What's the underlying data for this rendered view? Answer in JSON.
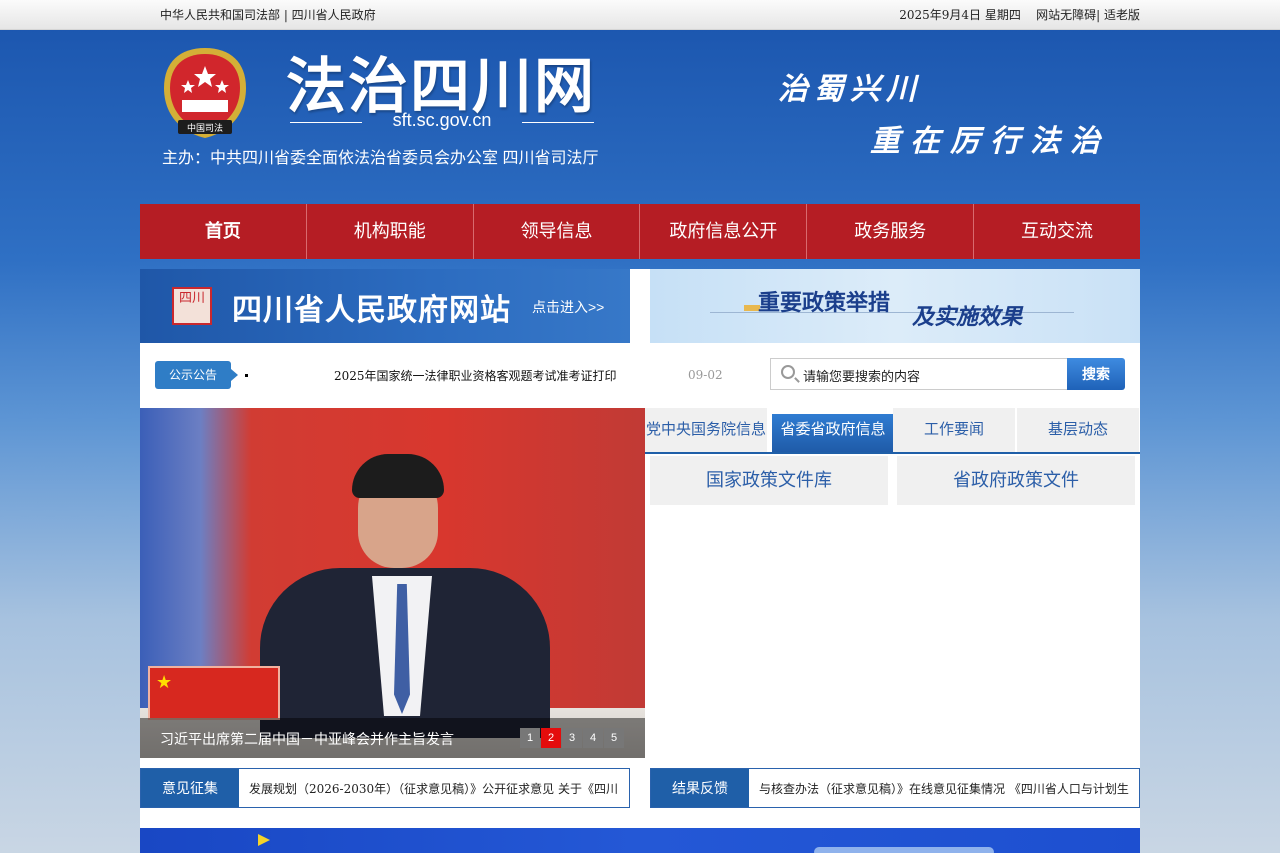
{
  "topbar": {
    "left_links": "中华人民共和国司法部 | 四川省人民政府",
    "date": "2025年9月4日 星期四",
    "accessibility": "网站无障碍",
    "separator": "|",
    "elder_mode": "适老版"
  },
  "header": {
    "emblem_label": "中国司法",
    "site_title": "法治四川网",
    "domain": "sft.sc.gov.cn",
    "sponsor": "主办：中共四川省委全面依法治省委员会办公室    四川省司法厅",
    "slogan_line1": "治蜀兴川",
    "slogan_line2": "重在厉行法治"
  },
  "nav": {
    "items": [
      {
        "label": "首页"
      },
      {
        "label": "机构职能"
      },
      {
        "label": "领导信息"
      },
      {
        "label": "政府信息公开"
      },
      {
        "label": "政务服务"
      },
      {
        "label": "互动交流"
      }
    ]
  },
  "banners": {
    "gov_site_seal": "四川",
    "gov_site_title": "四川省人民政府网站",
    "gov_site_enter": "点击进入>>",
    "policy_title_1": "重要政策举措",
    "policy_title_2": "及实施效果"
  },
  "notice": {
    "tag": "公示公告",
    "text": "2025年国家统一法律职业资格客观题考试准考证打印",
    "date": "09-02"
  },
  "search": {
    "placeholder": "请输您要搜索的内容",
    "button": "搜索"
  },
  "slider": {
    "caption": "习近平出席第二届中国－中亚峰会并作主旨发言",
    "pages": [
      "1",
      "2",
      "3",
      "4",
      "5"
    ],
    "active_page": 2
  },
  "tabs": {
    "items": [
      {
        "label": "党中央国务院信息"
      },
      {
        "label": "省委省政府信息"
      },
      {
        "label": "工作要闻"
      },
      {
        "label": "基层动态"
      }
    ],
    "active": 1,
    "sub_buttons": [
      {
        "label": "国家政策文件库"
      },
      {
        "label": "省政府政策文件"
      }
    ]
  },
  "tickers": {
    "opinion": {
      "tag": "意见征集",
      "text": "发展规划（2026-2030年）（征求意见稿）》公开征求意见      关于《四川"
    },
    "feedback": {
      "tag": "结果反馈",
      "text": "与核查办法（征求意见稿）》在线意见征集情况      《四川省人口与计划生"
    }
  },
  "colors": {
    "nav_red": "#b51d24",
    "primary_blue": "#1f5fa8",
    "active_dot": "#e40c0c"
  }
}
